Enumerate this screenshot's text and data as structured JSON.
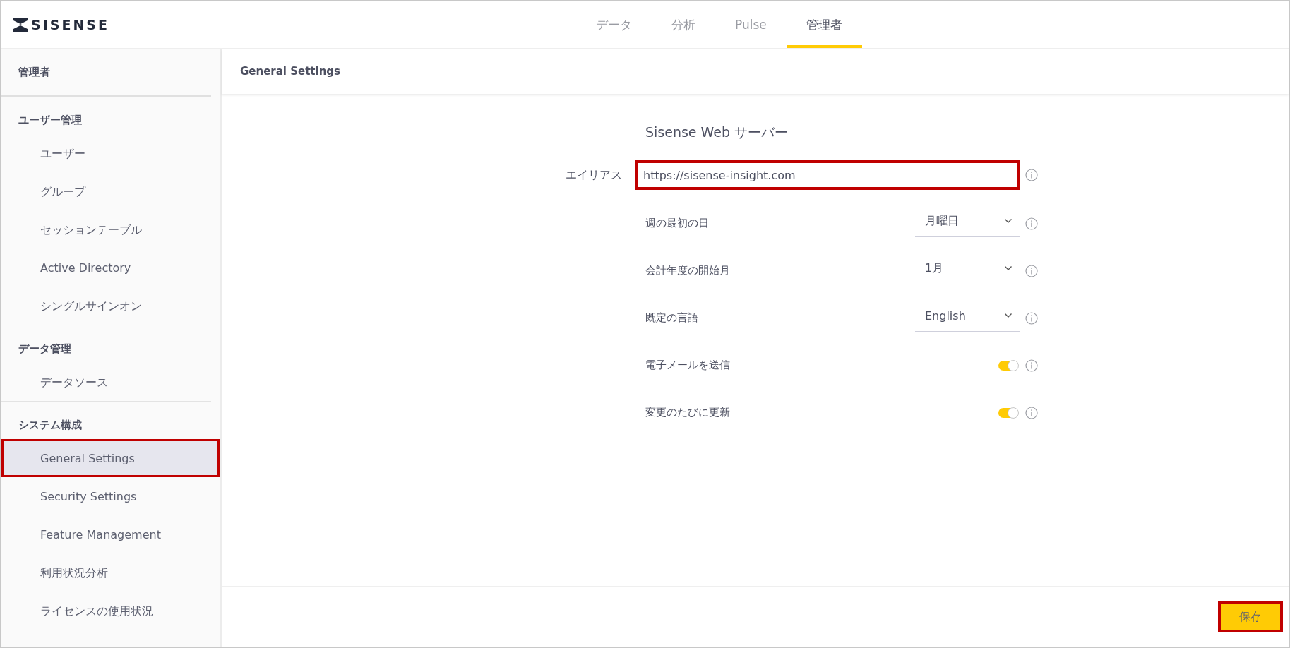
{
  "header": {
    "logo": "SISENSE",
    "tabs": [
      {
        "label": "データ",
        "selected": false
      },
      {
        "label": "分析",
        "selected": false
      },
      {
        "label": "Pulse",
        "selected": false
      },
      {
        "label": "管理者",
        "selected": true
      }
    ]
  },
  "sidebar": {
    "title": "管理者",
    "groups": [
      {
        "title": "ユーザー管理",
        "items": [
          {
            "label": "ユーザー",
            "selected": false,
            "highlighted": false
          },
          {
            "label": "グループ",
            "selected": false,
            "highlighted": false
          },
          {
            "label": "セッションテーブル",
            "selected": false,
            "highlighted": false
          },
          {
            "label": "Active Directory",
            "selected": false,
            "highlighted": false
          },
          {
            "label": "シングルサインオン",
            "selected": false,
            "highlighted": false
          }
        ]
      },
      {
        "title": "データ管理",
        "items": [
          {
            "label": "データソース",
            "selected": false,
            "highlighted": false
          }
        ]
      },
      {
        "title": "システム構成",
        "items": [
          {
            "label": "General Settings",
            "selected": true,
            "highlighted": true
          },
          {
            "label": "Security Settings",
            "selected": false,
            "highlighted": false
          },
          {
            "label": "Feature Management",
            "selected": false,
            "highlighted": false
          },
          {
            "label": "利用状況分析",
            "selected": false,
            "highlighted": false
          },
          {
            "label": "ライセンスの使用状況",
            "selected": false,
            "highlighted": false
          }
        ]
      }
    ]
  },
  "content": {
    "title": "General Settings",
    "section_title": "Sisense Web サーバー",
    "alias": {
      "label": "エイリアス",
      "value": "https://sisense-insight.com",
      "highlighted": true
    },
    "settings": [
      {
        "kind": "dropdown",
        "label": "週の最初の日",
        "value": "月曜日"
      },
      {
        "kind": "dropdown",
        "label": "会計年度の開始月",
        "value": "1月"
      },
      {
        "kind": "dropdown",
        "label": "既定の言語",
        "value": "English"
      },
      {
        "kind": "toggle",
        "label": "電子メールを送信",
        "on": true
      },
      {
        "kind": "toggle",
        "label": "変更のたびに更新",
        "on": true
      }
    ]
  },
  "footer": {
    "save_button": {
      "label": "保存",
      "highlighted": true
    }
  }
}
